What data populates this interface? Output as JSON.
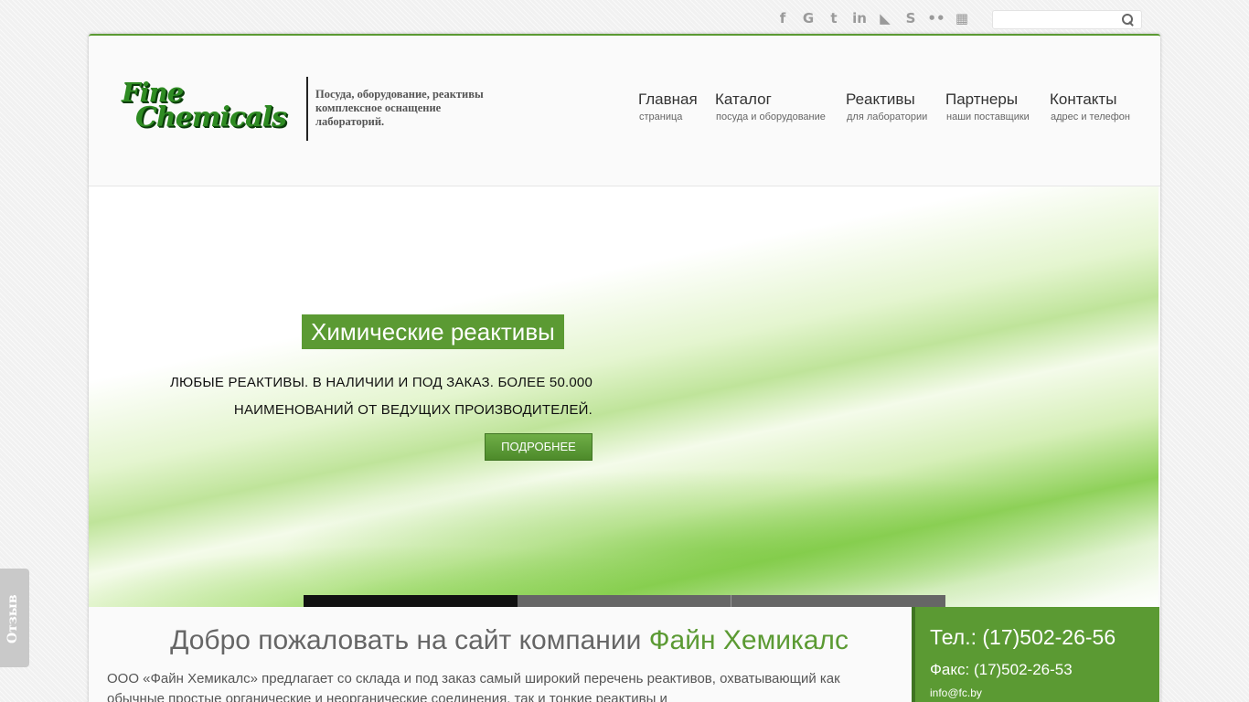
{
  "social_icons": [
    {
      "name": "facebook-icon",
      "glyph": "f"
    },
    {
      "name": "google-icon",
      "glyph": "G"
    },
    {
      "name": "twitter-icon",
      "glyph": "t"
    },
    {
      "name": "linkedin-icon",
      "glyph": "in"
    },
    {
      "name": "rss-icon",
      "glyph": "◣"
    },
    {
      "name": "skype-icon",
      "glyph": "S"
    },
    {
      "name": "flickr-icon",
      "glyph": "••"
    },
    {
      "name": "windows-icon",
      "glyph": "▦"
    }
  ],
  "search": {
    "placeholder": ""
  },
  "logo": {
    "line1": "Fine",
    "line2": "Chemicals"
  },
  "tagline": "Посуда, оборудование, реактивы комплексное оснащение лабораторий.",
  "nav": [
    {
      "title": "Главная",
      "sub": "страница"
    },
    {
      "title": "Каталог",
      "sub": "посуда и оборудование"
    },
    {
      "title": "Реактивы",
      "sub": "для лаборатории"
    },
    {
      "title": "Партнеры",
      "sub": "наши поставщики"
    },
    {
      "title": "Контакты",
      "sub": "адрес и телефон"
    }
  ],
  "slide": {
    "title": "Химические реактивы",
    "text_line1": "ЛЮБЫЕ РЕАКТИВЫ. В НАЛИЧИИ И ПОД ЗАКАЗ. БОЛЕЕ 50.000",
    "text_line2": "НАИМЕНОВАНИЙ ОТ ВЕДУЩИХ ПРОИЗВОДИТЕЛЕЙ.",
    "button": "ПОДРОБНЕЕ"
  },
  "welcome": {
    "title_prefix": "Добро пожаловать на сайт компании",
    "title_highlight": "Файн Хемикалс",
    "text": "ООО «Файн Хемикалс» предлагает со склада и под заказ самый широкий перечень реактивов, охватывающий как обычные простые органические и неорганические соединения, так и тонкие реактивы и"
  },
  "contact": {
    "tel": "Тел.: (17)502-26-56",
    "fax": "Факс: (17)502-26-53",
    "email": "info@fc.by"
  },
  "feedback": "Отзыв",
  "colors": {
    "accent": "#5b9a33",
    "accent_dark": "#3f7422"
  }
}
